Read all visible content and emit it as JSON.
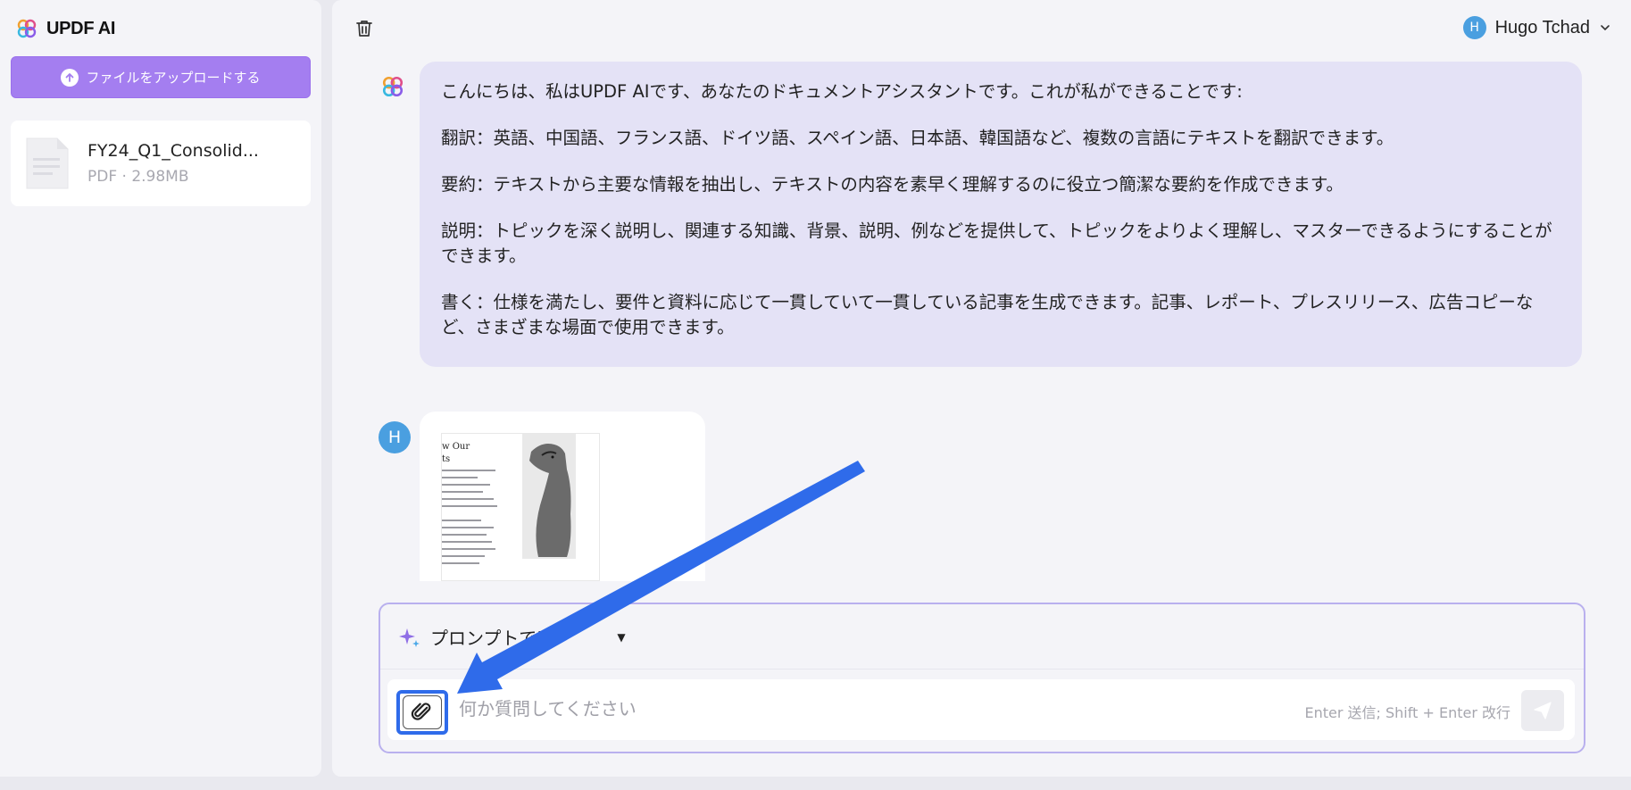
{
  "sidebar": {
    "brand_name": "UPDF AI",
    "upload_label": "ファイルをアップロードする",
    "file": {
      "name": "FY24_Q1_Consolid...",
      "meta": "PDF · 2.98MB"
    }
  },
  "header": {
    "user_name": "Hugo Tchad",
    "user_initial": "H"
  },
  "chat": {
    "ai_message": [
      "こんにちは、私はUPDF AIです、あなたのドキュメントアシスタントです。これが私ができることです:",
      "翻訳：英語、中国語、フランス語、ドイツ語、スペイン語、日本語、韓国語など、複数の言語にテキストを翻訳できます。",
      "要約：テキストから主要な情報を抽出し、テキストの内容を素早く理解するのに役立つ簡潔な要約を作成できます。",
      "説明：トピックを深く説明し、関連する知識、背景、説明、例などを提供して、トピックをよりよく理解し、マスターできるようにすることができます。",
      "書く：仕様を満たし、要件と資料に応じて一貫していて一貫している記事を生成できます。記事、レポート、プレスリリース、広告コピーなど、さまざまな場面で使用できます。"
    ],
    "user_initial": "H",
    "preview_title_1": "w Our",
    "preview_title_2": "ts"
  },
  "composer": {
    "prompt_label": "プロンプトで表",
    "input_placeholder": "何か質問してください",
    "hint": "Enter 送信; Shift + Enter 改行"
  },
  "colors": {
    "accent": "#a47ef0",
    "annotation_arrow": "#2f6bea",
    "ai_bubble": "#e4e2f6",
    "avatar": "#4a9fe0"
  },
  "icons": [
    "updf-logo-icon",
    "upload-arrow-icon",
    "pdf-file-icon",
    "trash-icon",
    "chevron-down-icon",
    "sparkle-icon",
    "paperclip-icon",
    "send-icon"
  ]
}
